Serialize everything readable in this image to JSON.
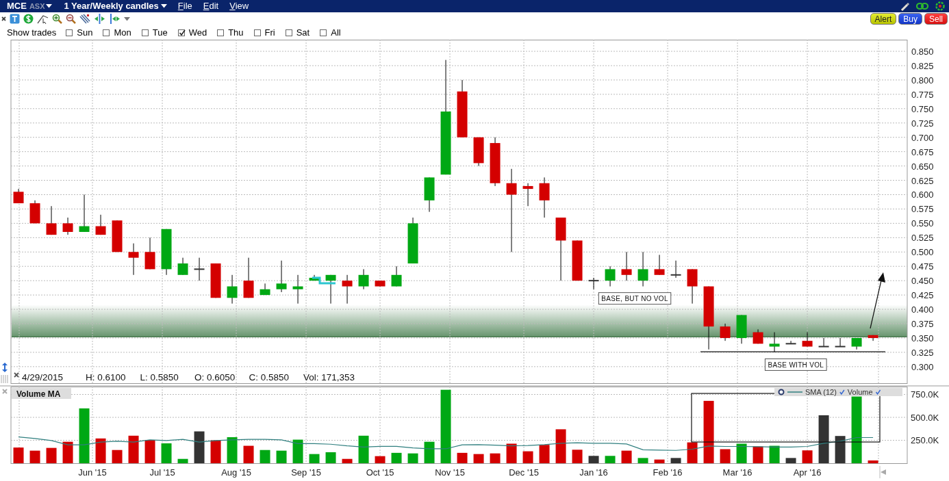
{
  "header": {
    "symbol": "MCE",
    "exchange": "ASX",
    "period": "1 Year/Weekly candles",
    "menus": [
      "File",
      "Edit",
      "View"
    ]
  },
  "toolbar": {
    "buttons": [
      {
        "label": "Alert",
        "kind": "alert"
      },
      {
        "label": "Buy",
        "kind": "buy"
      },
      {
        "label": "Sell",
        "kind": "sell"
      }
    ]
  },
  "show_trades": {
    "label": "Show trades",
    "days": [
      {
        "label": "Sun",
        "checked": false
      },
      {
        "label": "Mon",
        "checked": false
      },
      {
        "label": "Tue",
        "checked": false
      },
      {
        "label": "Wed",
        "checked": true
      },
      {
        "label": "Thu",
        "checked": false
      },
      {
        "label": "Fri",
        "checked": false
      },
      {
        "label": "Sat",
        "checked": false
      },
      {
        "label": "All",
        "checked": false
      }
    ]
  },
  "price_chart": {
    "chart_data": {
      "type": "candlestick",
      "ylim": [
        0.2712,
        0.8703
      ],
      "grid": true,
      "categories": [
        null,
        null,
        null,
        null,
        null,
        null,
        null,
        null,
        null,
        null,
        null,
        null,
        null,
        null,
        null,
        null,
        null,
        null,
        null,
        null,
        null,
        null,
        null,
        null,
        null,
        null,
        null,
        null,
        null,
        null,
        null,
        null,
        null,
        null,
        null,
        null,
        null,
        null,
        null,
        null,
        null,
        null,
        null,
        null,
        null,
        null,
        null,
        null,
        null,
        null,
        null,
        null,
        null
      ],
      "ohlc": [
        [
          0.605,
          0.61,
          0.585,
          0.585
        ],
        [
          0.585,
          0.59,
          0.55,
          0.55
        ],
        [
          0.55,
          0.58,
          0.53,
          0.53
        ],
        [
          0.55,
          0.56,
          0.53,
          0.535
        ],
        [
          0.535,
          0.6,
          0.535,
          0.545
        ],
        [
          0.545,
          0.565,
          0.53,
          0.53
        ],
        [
          0.555,
          0.555,
          0.5,
          0.5
        ],
        [
          0.5,
          0.515,
          0.46,
          0.49
        ],
        [
          0.5,
          0.525,
          0.47,
          0.47
        ],
        [
          0.47,
          0.54,
          0.46,
          0.54
        ],
        [
          0.46,
          0.49,
          0.46,
          0.48
        ],
        [
          0.47,
          0.49,
          0.45,
          0.47
        ],
        [
          0.48,
          0.48,
          0.42,
          0.42
        ],
        [
          0.42,
          0.46,
          0.41,
          0.44
        ],
        [
          0.45,
          0.49,
          0.42,
          0.42
        ],
        [
          0.425,
          0.445,
          0.425,
          0.435
        ],
        [
          0.435,
          0.485,
          0.43,
          0.445
        ],
        [
          0.435,
          0.46,
          0.41,
          0.44
        ],
        [
          0.45,
          0.46,
          0.45,
          0.455
        ],
        [
          0.45,
          0.46,
          0.41,
          0.46
        ],
        [
          0.45,
          0.46,
          0.41,
          0.44
        ],
        [
          0.44,
          0.47,
          0.435,
          0.46
        ],
        [
          0.45,
          0.45,
          0.44,
          0.44
        ],
        [
          0.44,
          0.475,
          0.44,
          0.46
        ],
        [
          0.48,
          0.56,
          0.48,
          0.55
        ],
        [
          0.59,
          0.63,
          0.57,
          0.63
        ],
        [
          0.635,
          0.835,
          0.635,
          0.745
        ],
        [
          0.78,
          0.8,
          0.7,
          0.7
        ],
        [
          0.7,
          0.7,
          0.65,
          0.655
        ],
        [
          0.69,
          0.7,
          0.615,
          0.62
        ],
        [
          0.62,
          0.645,
          0.5,
          0.6
        ],
        [
          0.615,
          0.62,
          0.58,
          0.61
        ],
        [
          0.62,
          0.63,
          0.56,
          0.59
        ],
        [
          0.56,
          0.56,
          0.45,
          0.52
        ],
        [
          0.52,
          0.52,
          0.45,
          0.45
        ],
        [
          0.45,
          0.455,
          0.435,
          0.45
        ],
        [
          0.45,
          0.475,
          0.44,
          0.47
        ],
        [
          0.47,
          0.5,
          0.45,
          0.46
        ],
        [
          0.45,
          0.5,
          0.44,
          0.47
        ],
        [
          0.47,
          0.495,
          0.46,
          0.46
        ],
        [
          0.46,
          0.485,
          0.455,
          0.46
        ],
        [
          0.47,
          0.47,
          0.41,
          0.44
        ],
        [
          0.44,
          0.44,
          0.33,
          0.37
        ],
        [
          0.37,
          0.375,
          0.345,
          0.35
        ],
        [
          0.35,
          0.39,
          0.34,
          0.39
        ],
        [
          0.36,
          0.365,
          0.34,
          0.34
        ],
        [
          0.335,
          0.36,
          0.325,
          0.34
        ],
        [
          0.34,
          0.345,
          0.34,
          0.34
        ],
        [
          0.345,
          0.36,
          0.335,
          0.335
        ],
        [
          0.335,
          0.35,
          0.335,
          0.335
        ],
        [
          0.335,
          0.35,
          0.335,
          0.335
        ],
        [
          0.335,
          0.35,
          0.33,
          0.35
        ],
        [
          0.355,
          0.355,
          0.345,
          0.35
        ]
      ],
      "yticks": [
        {
          "value": 0.3,
          "label": "0.300"
        },
        {
          "value": 0.325,
          "label": "0.325"
        },
        {
          "value": 0.35,
          "label": "0.350"
        },
        {
          "value": 0.375,
          "label": "0.375"
        },
        {
          "value": 0.4,
          "label": "0.400"
        },
        {
          "value": 0.425,
          "label": "0.425"
        },
        {
          "value": 0.45,
          "label": "0.450"
        },
        {
          "value": 0.475,
          "label": "0.475"
        },
        {
          "value": 0.5,
          "label": "0.500"
        },
        {
          "value": 0.525,
          "label": "0.525"
        },
        {
          "value": 0.55,
          "label": "0.550"
        },
        {
          "value": 0.575,
          "label": "0.575"
        },
        {
          "value": 0.6,
          "label": "0.600"
        },
        {
          "value": 0.625,
          "label": "0.625"
        },
        {
          "value": 0.65,
          "label": "0.650"
        },
        {
          "value": 0.675,
          "label": "0.675"
        },
        {
          "value": 0.7,
          "label": "0.700"
        },
        {
          "value": 0.725,
          "label": "0.725"
        },
        {
          "value": 0.75,
          "label": "0.750"
        },
        {
          "value": 0.775,
          "label": "0.775"
        },
        {
          "value": 0.8,
          "label": "0.800"
        },
        {
          "value": 0.825,
          "label": "0.825"
        },
        {
          "value": 0.85,
          "label": "0.850"
        }
      ],
      "annotations": [
        "BASE, BUT NO VOL",
        "BASE WITH VOL"
      ]
    },
    "info_line": {
      "date": "4/29/2015",
      "items": [
        "H: 0.6100",
        "L: 0.5850",
        "O: 0.6050",
        "C: 0.5850",
        "Vol: 171,353"
      ]
    }
  },
  "volume_chart": {
    "month_labels": [
      "Jun '15",
      "Jul '15",
      "Aug '15",
      "Sep '15",
      "Oct '15",
      "Nov '15",
      "Dec '15",
      "Jan '16",
      "Feb '16",
      "Mar '16",
      "Apr '16"
    ],
    "chart_data": {
      "type": "bar",
      "title": "Volume MA",
      "ylim": [
        0,
        835800
      ],
      "grid": true,
      "series": [
        {
          "name": "SMA (12)",
          "type": "line",
          "color": "#2f7f7f",
          "values": [
            287000,
            270000,
            247000,
            200000,
            200000,
            230000,
            240000,
            230000,
            254000,
            247000,
            260000,
            230000,
            247000,
            254000,
            260000,
            260000,
            254000,
            214000,
            214000,
            207000,
            190000,
            177000,
            184000,
            184000,
            167000,
            157000,
            157000,
            200000,
            203000,
            197000,
            190000,
            193000,
            203000,
            217000,
            223000,
            217000,
            217000,
            210000,
            147000,
            143000,
            140000,
            153000,
            187000,
            183000,
            183000,
            180000,
            177000,
            177000,
            183000,
            217000,
            240000,
            280000,
            280000
          ]
        },
        {
          "name": "Volume",
          "values": [
            171000,
            137000,
            167000,
            234000,
            598000,
            270000,
            144000,
            300000,
            254000,
            217000,
            47000,
            347000,
            250000,
            284000,
            190000,
            144000,
            137000,
            257000,
            100000,
            120000,
            47000,
            300000,
            77000,
            113000,
            107000,
            234000,
            801000,
            113000,
            100000,
            107000,
            213000,
            130000,
            200000,
            370000,
            147000,
            80000,
            80000,
            137000,
            57000,
            40000,
            57000,
            227000,
            680000,
            153000,
            213000,
            183000,
            190000,
            57000,
            140000,
            523000,
            297000,
            727000,
            30000
          ],
          "colors": [
            "#d40000",
            "#d40000",
            "#d40000",
            "#d40000",
            "#00a814",
            "#d40000",
            "#d40000",
            "#d40000",
            "#d40000",
            "#00a814",
            "#00a814",
            "#333333",
            "#d40000",
            "#00a814",
            "#d40000",
            "#00a814",
            "#00a814",
            "#00a814",
            "#00a814",
            "#00a814",
            "#d40000",
            "#00a814",
            "#d40000",
            "#00a814",
            "#00a814",
            "#00a814",
            "#00a814",
            "#d40000",
            "#d40000",
            "#d40000",
            "#d40000",
            "#d40000",
            "#d40000",
            "#d40000",
            "#d40000",
            "#333333",
            "#00a814",
            "#d40000",
            "#00a814",
            "#d40000",
            "#333333",
            "#d40000",
            "#d40000",
            "#d40000",
            "#00a814",
            "#d40000",
            "#00a814",
            "#333333",
            "#d40000",
            "#333333",
            "#333333",
            "#00a814",
            "#d40000"
          ]
        }
      ],
      "yticks": [
        {
          "value": 250000,
          "label": "250.0K"
        },
        {
          "value": 500000,
          "label": "500.0K"
        },
        {
          "value": 750000,
          "label": "750.0K"
        }
      ]
    }
  }
}
